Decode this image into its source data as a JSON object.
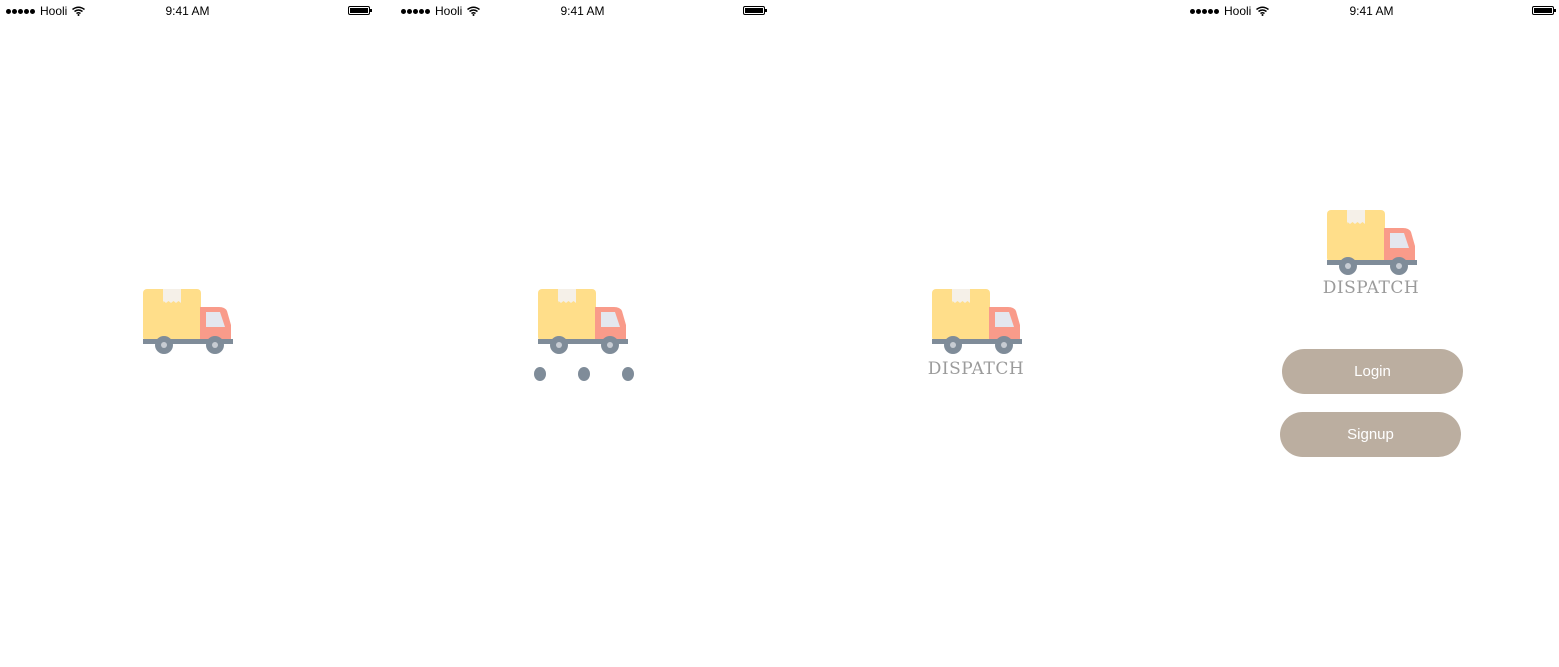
{
  "status_bar": {
    "carrier": "Hooli",
    "time": "9:41 AM"
  },
  "brand": {
    "name": "DISPATCH"
  },
  "actions": {
    "login": "Login",
    "signup": "Signup"
  },
  "colors": {
    "box": "#FFDE8A",
    "tape": "#F5F0E8",
    "cab": "#F99B8A",
    "window": "#E4E7EE",
    "chassis": "#7F8C99",
    "hub": "#C7CCD3",
    "text_muted": "#9B9B9B",
    "button": "#BBAEA0"
  },
  "icons": [
    "signal-icon",
    "wifi-icon",
    "battery-icon",
    "delivery-truck-icon",
    "loading-dots-icon"
  ]
}
